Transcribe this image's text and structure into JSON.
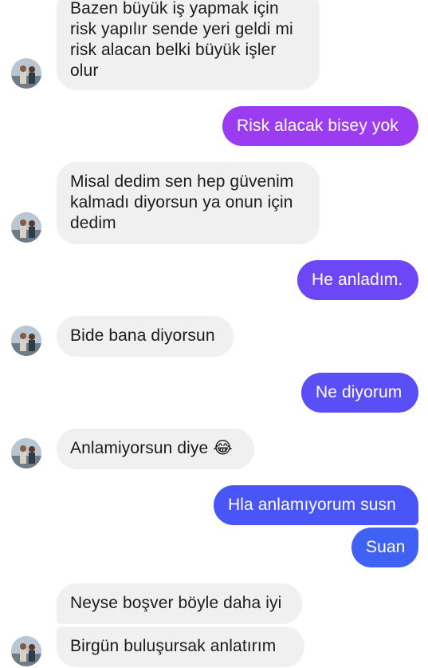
{
  "messages": [
    {
      "side": "in",
      "text": "Bazen büyük iş yapmak için\nrisk yapılır  sende yeri geldi mi\nrisk alacan belki büyük işler\nolur"
    },
    {
      "side": "out",
      "text": "Risk alacak bisey yok",
      "color": "#9b3cf2"
    },
    {
      "side": "in",
      "text": "Misal dedim sen hep güvenim\nkalmadı diyorsun ya onun için\ndedim"
    },
    {
      "side": "out",
      "text": "He anladım.",
      "color": "#6d47f5"
    },
    {
      "side": "in",
      "text": "Bide bana diyorsun"
    },
    {
      "side": "out",
      "text": "Ne diyorum",
      "color": "#5a4ff6"
    },
    {
      "side": "in",
      "text": "Anlamiyorsun diye 😂"
    },
    {
      "side": "out",
      "text": "Hla anlamıyorum susn",
      "color": "#4a55f7"
    },
    {
      "side": "out",
      "text": "Suan",
      "color": "#3f62f4"
    },
    {
      "side": "in",
      "text": "Neyse boşver böyle daha iyi"
    },
    {
      "side": "in",
      "text": "Birgün buluşursak  anlatırım"
    }
  ],
  "colors": {
    "incoming_bubble": "#f0f0f0",
    "incoming_text": "#1c1c1c",
    "outgoing_text": "#ffffff"
  },
  "icons": {
    "avatar": "contact-avatar-icon"
  }
}
